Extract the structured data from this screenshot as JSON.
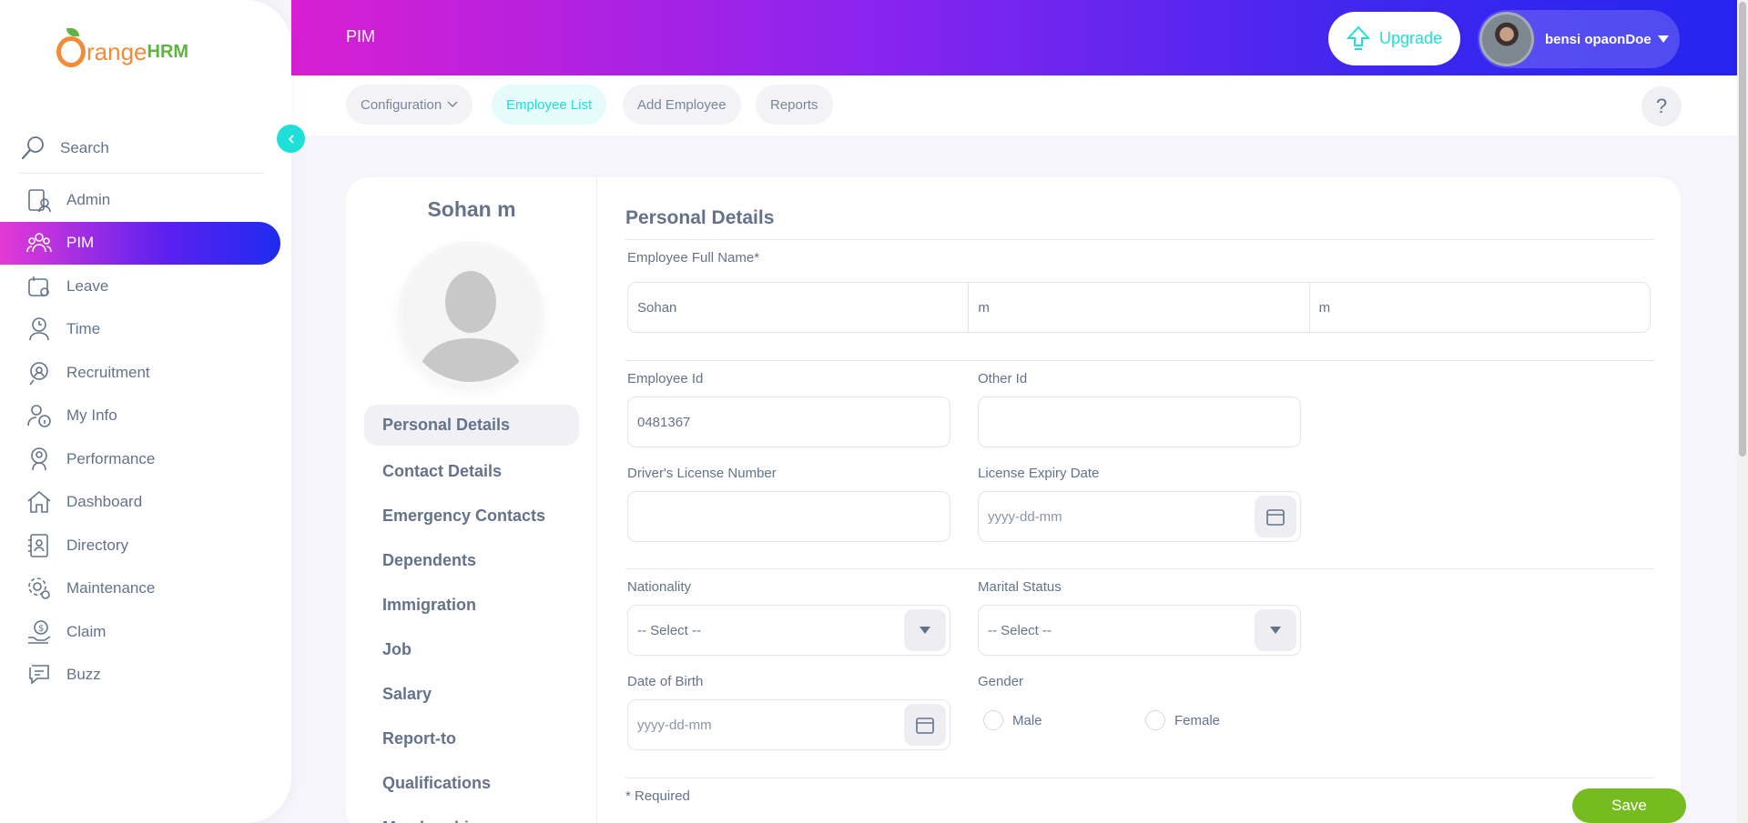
{
  "app": {
    "logo_main": "range",
    "logo_suffix": "HRM"
  },
  "sidebar": {
    "search_label": "Search",
    "items": [
      {
        "label": "Admin",
        "icon": "admin-icon"
      },
      {
        "label": "PIM",
        "icon": "pim-icon",
        "active": true
      },
      {
        "label": "Leave",
        "icon": "leave-icon"
      },
      {
        "label": "Time",
        "icon": "time-icon"
      },
      {
        "label": "Recruitment",
        "icon": "recruitment-icon"
      },
      {
        "label": "My Info",
        "icon": "my-info-icon"
      },
      {
        "label": "Performance",
        "icon": "performance-icon"
      },
      {
        "label": "Dashboard",
        "icon": "dashboard-icon"
      },
      {
        "label": "Directory",
        "icon": "directory-icon"
      },
      {
        "label": "Maintenance",
        "icon": "maintenance-icon"
      },
      {
        "label": "Claim",
        "icon": "claim-icon"
      },
      {
        "label": "Buzz",
        "icon": "buzz-icon"
      }
    ]
  },
  "topbar": {
    "title": "PIM",
    "upgrade_label": "Upgrade",
    "user_name": "bensi opaonDoe"
  },
  "subnav": {
    "tabs": [
      {
        "label": "Configuration",
        "has_dropdown": true
      },
      {
        "label": "Employee List",
        "active": true
      },
      {
        "label": "Add Employee"
      },
      {
        "label": "Reports"
      }
    ],
    "help_label": "?"
  },
  "profile": {
    "name": "Sohan m",
    "menu": [
      "Personal Details",
      "Contact Details",
      "Emergency Contacts",
      "Dependents",
      "Immigration",
      "Job",
      "Salary",
      "Report-to",
      "Qualifications",
      "Memberships"
    ]
  },
  "form": {
    "title": "Personal Details",
    "full_name_label": "Employee Full Name*",
    "first_name": "Sohan",
    "middle_name": "m",
    "last_name": "m",
    "employee_id_label": "Employee Id",
    "employee_id": "0481367",
    "other_id_label": "Other Id",
    "other_id": "",
    "license_label": "Driver's License Number",
    "license_value": "",
    "license_expiry_label": "License Expiry Date",
    "license_expiry_placeholder": "yyyy-dd-mm",
    "nationality_label": "Nationality",
    "nationality_value": "-- Select --",
    "marital_label": "Marital Status",
    "marital_value": "-- Select --",
    "dob_label": "Date of Birth",
    "dob_placeholder": "yyyy-dd-mm",
    "gender_label": "Gender",
    "gender_male": "Male",
    "gender_female": "Female",
    "required_note": "* Required",
    "save_label": "Save"
  },
  "colors": {
    "accent": "#1ee0d9",
    "save": "#76bc21",
    "gradient_start": "#d81fd2",
    "gradient_end": "#2524ee"
  }
}
